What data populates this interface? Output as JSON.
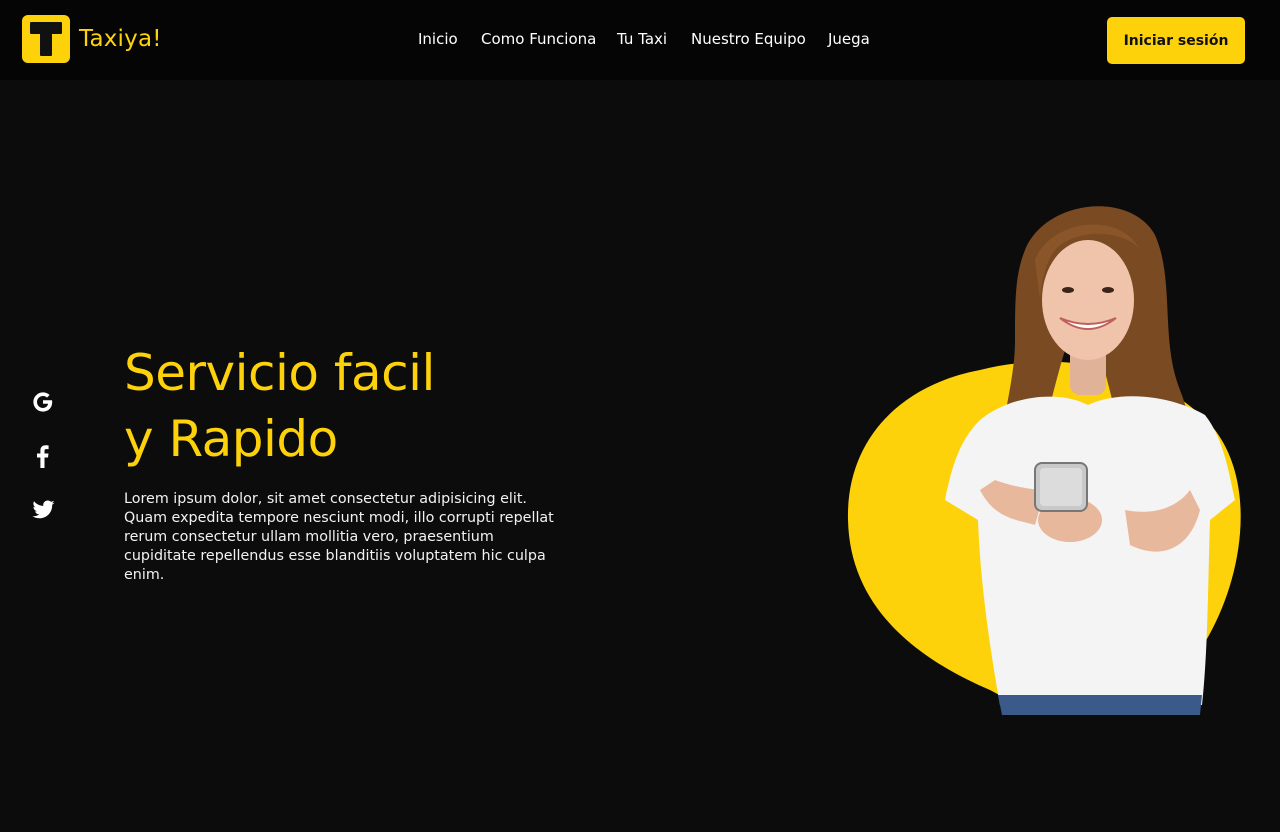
{
  "brand": {
    "name": "Taxiya!",
    "logo_letter": "T",
    "accent_color": "#fdd20a"
  },
  "nav": {
    "items": [
      {
        "label": "Inicio"
      },
      {
        "label": "Como Funciona"
      },
      {
        "label": "Tu Taxi"
      },
      {
        "label": "Nuestro Equipo"
      },
      {
        "label": "Juega"
      }
    ],
    "login_label": "Iniciar sesión"
  },
  "social": [
    {
      "icon": "google-icon"
    },
    {
      "icon": "facebook-icon"
    },
    {
      "icon": "twitter-icon"
    }
  ],
  "hero": {
    "title_line1": "Servicio facil",
    "title_line2": "y Rapido",
    "text": "Lorem ipsum dolor, sit amet consectetur adipisicing elit. Quam expedita tempore nesciunt modi, illo corrupti repellat rerum consectetur ullam mollitia vero, praesentium cupiditate repellendus esse blanditiis voluptatem hic culpa enim.",
    "image": "smiling-woman-holding-phone"
  }
}
